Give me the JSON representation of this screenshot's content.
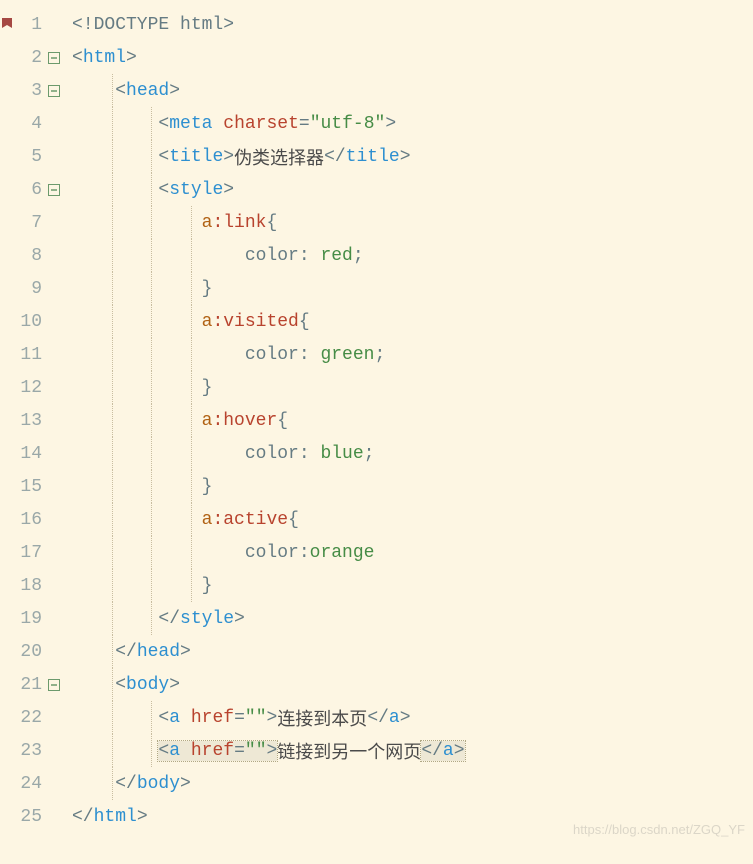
{
  "watermark": "https://blog.csdn.net/ZGQ_YF",
  "gutter": [
    {
      "n": "1",
      "bookmark": true,
      "fold": ""
    },
    {
      "n": "2",
      "bookmark": false,
      "fold": "⊟"
    },
    {
      "n": "3",
      "bookmark": false,
      "fold": "⊟"
    },
    {
      "n": "4",
      "bookmark": false,
      "fold": ""
    },
    {
      "n": "5",
      "bookmark": false,
      "fold": ""
    },
    {
      "n": "6",
      "bookmark": false,
      "fold": "⊟"
    },
    {
      "n": "7",
      "bookmark": false,
      "fold": ""
    },
    {
      "n": "8",
      "bookmark": false,
      "fold": ""
    },
    {
      "n": "9",
      "bookmark": false,
      "fold": ""
    },
    {
      "n": "10",
      "bookmark": false,
      "fold": ""
    },
    {
      "n": "11",
      "bookmark": false,
      "fold": ""
    },
    {
      "n": "12",
      "bookmark": false,
      "fold": ""
    },
    {
      "n": "13",
      "bookmark": false,
      "fold": ""
    },
    {
      "n": "14",
      "bookmark": false,
      "fold": ""
    },
    {
      "n": "15",
      "bookmark": false,
      "fold": ""
    },
    {
      "n": "16",
      "bookmark": false,
      "fold": ""
    },
    {
      "n": "17",
      "bookmark": false,
      "fold": ""
    },
    {
      "n": "18",
      "bookmark": false,
      "fold": ""
    },
    {
      "n": "19",
      "bookmark": false,
      "fold": ""
    },
    {
      "n": "20",
      "bookmark": false,
      "fold": ""
    },
    {
      "n": "21",
      "bookmark": false,
      "fold": "⊟"
    },
    {
      "n": "22",
      "bookmark": false,
      "fold": ""
    },
    {
      "n": "23",
      "bookmark": false,
      "fold": ""
    },
    {
      "n": "24",
      "bookmark": false,
      "fold": ""
    },
    {
      "n": "25",
      "bookmark": false,
      "fold": ""
    }
  ],
  "code": [
    [
      {
        "c": "kw",
        "t": "<!DOCTYPE html>"
      }
    ],
    [
      {
        "c": "punc",
        "t": "<"
      },
      {
        "c": "tag",
        "t": "html"
      },
      {
        "c": "punc",
        "t": ">"
      }
    ],
    [
      {
        "c": "sp",
        "t": "    "
      },
      {
        "c": "punc",
        "t": "<"
      },
      {
        "c": "tag",
        "t": "head"
      },
      {
        "c": "punc",
        "t": ">"
      }
    ],
    [
      {
        "c": "sp",
        "t": "        "
      },
      {
        "c": "punc",
        "t": "<"
      },
      {
        "c": "tag",
        "t": "meta"
      },
      {
        "c": "text",
        "t": " "
      },
      {
        "c": "attr",
        "t": "charset"
      },
      {
        "c": "punc",
        "t": "="
      },
      {
        "c": "str",
        "t": "\"utf-8\""
      },
      {
        "c": "punc",
        "t": ">"
      }
    ],
    [
      {
        "c": "sp",
        "t": "        "
      },
      {
        "c": "punc",
        "t": "<"
      },
      {
        "c": "tag",
        "t": "title"
      },
      {
        "c": "punc",
        "t": ">"
      },
      {
        "c": "text",
        "t": "伪类选择器"
      },
      {
        "c": "punc",
        "t": "</"
      },
      {
        "c": "tag",
        "t": "title"
      },
      {
        "c": "punc",
        "t": ">"
      }
    ],
    [
      {
        "c": "sp",
        "t": "        "
      },
      {
        "c": "punc",
        "t": "<"
      },
      {
        "c": "tag",
        "t": "style"
      },
      {
        "c": "punc",
        "t": ">"
      }
    ],
    [
      {
        "c": "sp",
        "t": "            "
      },
      {
        "c": "sel",
        "t": "a"
      },
      {
        "c": "pseudo",
        "t": ":link"
      },
      {
        "c": "punc",
        "t": "{"
      }
    ],
    [
      {
        "c": "sp",
        "t": "                "
      },
      {
        "c": "prop",
        "t": "color"
      },
      {
        "c": "punc",
        "t": ": "
      },
      {
        "c": "val",
        "t": "red"
      },
      {
        "c": "punc",
        "t": ";"
      }
    ],
    [
      {
        "c": "sp",
        "t": "            "
      },
      {
        "c": "punc",
        "t": "}"
      }
    ],
    [
      {
        "c": "sp",
        "t": "            "
      },
      {
        "c": "sel",
        "t": "a"
      },
      {
        "c": "pseudo",
        "t": ":visited"
      },
      {
        "c": "punc",
        "t": "{"
      }
    ],
    [
      {
        "c": "sp",
        "t": "                "
      },
      {
        "c": "prop",
        "t": "color"
      },
      {
        "c": "punc",
        "t": ": "
      },
      {
        "c": "val",
        "t": "green"
      },
      {
        "c": "punc",
        "t": ";"
      }
    ],
    [
      {
        "c": "sp",
        "t": "            "
      },
      {
        "c": "punc",
        "t": "}"
      }
    ],
    [
      {
        "c": "sp",
        "t": "            "
      },
      {
        "c": "sel",
        "t": "a"
      },
      {
        "c": "pseudo",
        "t": ":hover"
      },
      {
        "c": "punc",
        "t": "{"
      }
    ],
    [
      {
        "c": "sp",
        "t": "                "
      },
      {
        "c": "prop",
        "t": "color"
      },
      {
        "c": "punc",
        "t": ": "
      },
      {
        "c": "val",
        "t": "blue"
      },
      {
        "c": "punc",
        "t": ";"
      }
    ],
    [
      {
        "c": "sp",
        "t": "            "
      },
      {
        "c": "punc",
        "t": "}"
      }
    ],
    [
      {
        "c": "sp",
        "t": "            "
      },
      {
        "c": "sel",
        "t": "a"
      },
      {
        "c": "pseudo",
        "t": ":active"
      },
      {
        "c": "punc",
        "t": "{"
      }
    ],
    [
      {
        "c": "sp",
        "t": "                "
      },
      {
        "c": "prop",
        "t": "color"
      },
      {
        "c": "punc",
        "t": ":"
      },
      {
        "c": "val",
        "t": "orange"
      }
    ],
    [
      {
        "c": "sp",
        "t": "            "
      },
      {
        "c": "punc",
        "t": "}"
      }
    ],
    [
      {
        "c": "sp",
        "t": "        "
      },
      {
        "c": "punc",
        "t": "</"
      },
      {
        "c": "tag",
        "t": "style"
      },
      {
        "c": "punc",
        "t": ">"
      }
    ],
    [
      {
        "c": "sp",
        "t": "    "
      },
      {
        "c": "punc",
        "t": "</"
      },
      {
        "c": "tag",
        "t": "head"
      },
      {
        "c": "punc",
        "t": ">"
      }
    ],
    [
      {
        "c": "sp",
        "t": "    "
      },
      {
        "c": "punc",
        "t": "<"
      },
      {
        "c": "tag",
        "t": "body"
      },
      {
        "c": "punc",
        "t": ">"
      }
    ],
    [
      {
        "c": "sp",
        "t": "        "
      },
      {
        "c": "punc",
        "t": "<"
      },
      {
        "c": "tag",
        "t": "a"
      },
      {
        "c": "text",
        "t": " "
      },
      {
        "c": "attr",
        "t": "href"
      },
      {
        "c": "punc",
        "t": "="
      },
      {
        "c": "str",
        "t": "\"\""
      },
      {
        "c": "punc",
        "t": ">"
      },
      {
        "c": "text",
        "t": "连接到本页"
      },
      {
        "c": "punc",
        "t": "</"
      },
      {
        "c": "tag",
        "t": "a"
      },
      {
        "c": "punc",
        "t": ">"
      }
    ],
    [
      {
        "c": "sp",
        "t": "        "
      },
      {
        "c": "hl-start",
        "t": ""
      },
      {
        "c": "punc",
        "t": "<"
      },
      {
        "c": "tag",
        "t": "a"
      },
      {
        "c": "text",
        "t": " "
      },
      {
        "c": "attr",
        "t": "href"
      },
      {
        "c": "punc",
        "t": "="
      },
      {
        "c": "str",
        "t": "\"\""
      },
      {
        "c": "punc",
        "t": ">"
      },
      {
        "c": "hl-end",
        "t": ""
      },
      {
        "c": "text",
        "t": "链接到另一个网页"
      },
      {
        "c": "hl-start",
        "t": ""
      },
      {
        "c": "punc",
        "t": "</"
      },
      {
        "c": "tag",
        "t": "a"
      },
      {
        "c": "punc",
        "t": ">"
      },
      {
        "c": "hl-end",
        "t": ""
      }
    ],
    [
      {
        "c": "sp",
        "t": "    "
      },
      {
        "c": "punc",
        "t": "</"
      },
      {
        "c": "tag",
        "t": "body"
      },
      {
        "c": "punc",
        "t": ">"
      }
    ],
    [
      {
        "c": "punc",
        "t": "</"
      },
      {
        "c": "tag",
        "t": "html"
      },
      {
        "c": "punc",
        "t": ">"
      }
    ]
  ],
  "bookmark_glyph": "◣"
}
